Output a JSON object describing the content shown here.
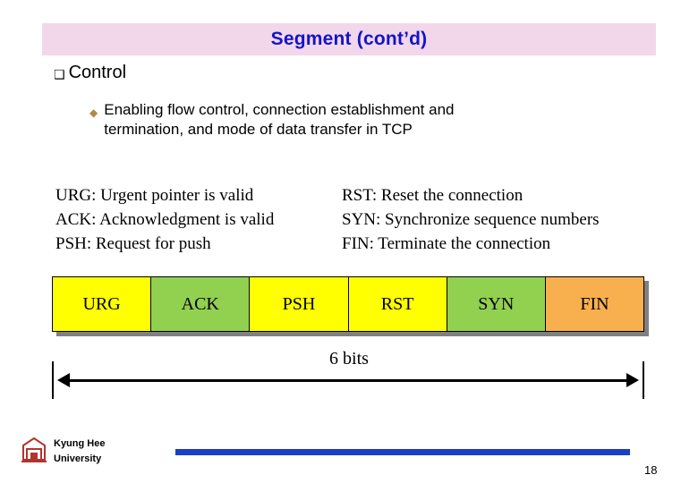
{
  "slide": {
    "title": "Segment (cont’d)",
    "title_color": "#1414c8",
    "title_bg": "#f2d7ea"
  },
  "bullets": {
    "level1": {
      "marker": "❑",
      "text": "Control"
    },
    "level2": {
      "marker": "◆",
      "line1": "Enabling flow control, connection establishment and",
      "line2": "termination, and mode of data transfer in TCP"
    }
  },
  "flag_descriptions": [
    {
      "left": "URG: Urgent pointer is valid",
      "right": "RST: Reset the connection"
    },
    {
      "left": "ACK: Acknowledgment is valid",
      "right": "SYN: Synchronize sequence numbers"
    },
    {
      "left": "PSH: Request for push",
      "right": "FIN: Terminate the connection"
    }
  ],
  "flag_bar": {
    "cells": [
      {
        "label": "URG",
        "color": "#ffff00"
      },
      {
        "label": "ACK",
        "color": "#92d050"
      },
      {
        "label": "PSH",
        "color": "#ffff00"
      },
      {
        "label": "RST",
        "color": "#ffff00"
      },
      {
        "label": "SYN",
        "color": "#92d050"
      },
      {
        "label": "FIN",
        "color": "#f8b04f"
      }
    ],
    "width_label": "6 bits"
  },
  "footer": {
    "university_line1": "Kyung Hee",
    "university_line2": "University",
    "rule_color": "#1a3fc4",
    "page_number": "18"
  }
}
